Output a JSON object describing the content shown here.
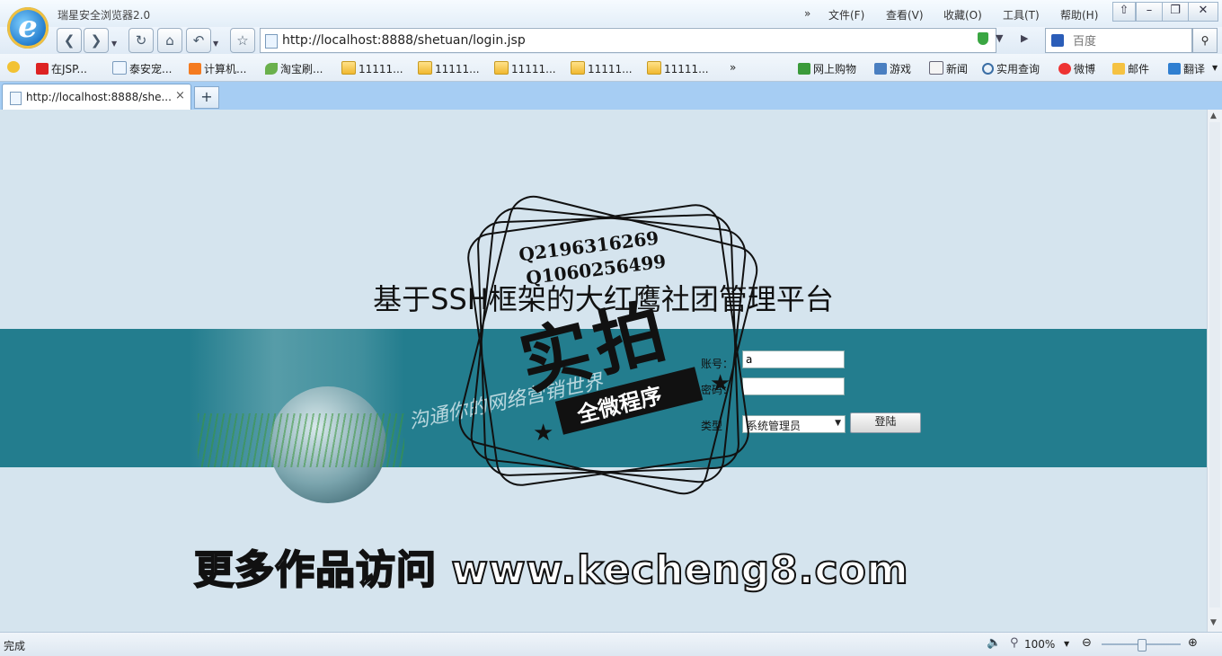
{
  "browser": {
    "app_title": "瑞星安全浏览器2.0",
    "menu": [
      "文件(F)",
      "查看(V)",
      "收藏(O)",
      "工具(T)",
      "帮助(H)"
    ],
    "menu_more": "»",
    "address": "http://localhost:8888/shetuan/login.jsp",
    "search_placeholder": "百度",
    "favorites": [
      {
        "label": "在JSP...",
        "icon": "red-c-icon"
      },
      {
        "label": "泰安宠...",
        "icon": "page-icon"
      },
      {
        "label": "计算机...",
        "icon": "taobao-icon"
      },
      {
        "label": "淘宝刷...",
        "icon": "bird-icon"
      },
      {
        "label": "11111...",
        "icon": "folder-icon"
      },
      {
        "label": "11111...",
        "icon": "folder-icon"
      },
      {
        "label": "11111...",
        "icon": "folder-icon"
      },
      {
        "label": "11111...",
        "icon": "folder-icon"
      },
      {
        "label": "11111...",
        "icon": "folder-icon"
      }
    ],
    "fav_more": "»",
    "quick_links": [
      "网上购物",
      "游戏",
      "新闻",
      "实用查询",
      "微博",
      "邮件",
      "翻译"
    ],
    "tab_label": "http://localhost:8888/she...",
    "tab_close": "×",
    "new_tab": "+",
    "status": "完成",
    "zoom": "100%"
  },
  "page": {
    "title": "基于SSH框架的大红鹰社团管理平台",
    "slogan": "沟通你的网络营销世界",
    "form": {
      "account_label": "账号：",
      "account_value": "a",
      "password_label": "密码：",
      "password_value": "",
      "type_label": "类型",
      "type_selected": "系统管理员",
      "login_button": "登陆"
    },
    "promo": "更多作品访问 www.kecheng8.com"
  },
  "watermark": {
    "qq1": "Q2196316269",
    "qq2": "Q1060256499",
    "main": "实拍",
    "sub": "全微程序"
  }
}
